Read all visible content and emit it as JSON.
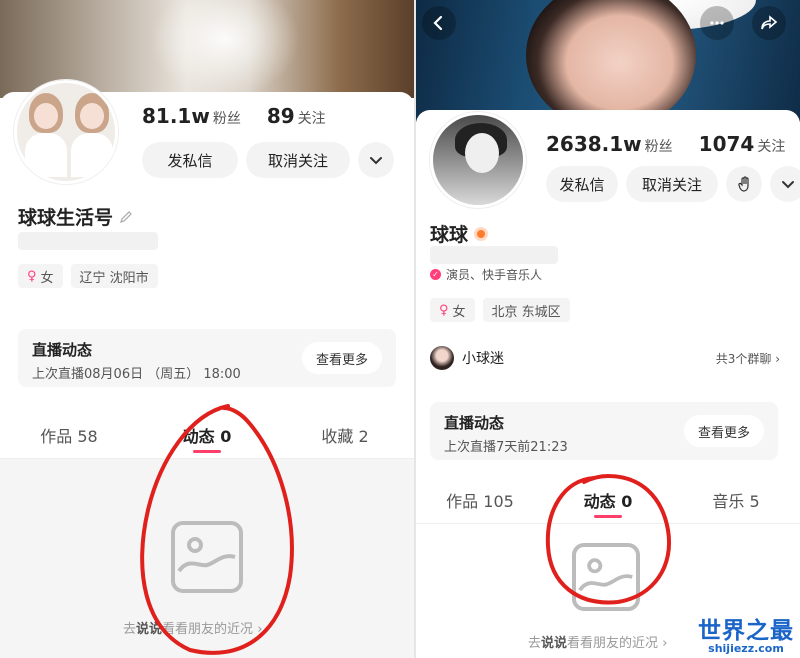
{
  "left": {
    "stats": {
      "fans_num": "81.1w",
      "fans_label": "粉丝",
      "follow_num": "89",
      "follow_label": "关注"
    },
    "actions": {
      "message": "发私信",
      "unfollow": "取消关注"
    },
    "name": "球球生活号",
    "tags": {
      "gender": "女",
      "location": "辽宁 沈阳市"
    },
    "live": {
      "title": "直播动态",
      "subtitle": "上次直播08月06日 （周五） 18:00",
      "more": "查看更多"
    },
    "tabs": [
      "作品 58",
      "动态 0",
      "收藏 2"
    ],
    "empty_hint": {
      "pre": "去",
      "strong": "说说",
      "post": "看看朋友的近况",
      "arrow": "›"
    }
  },
  "right": {
    "stats": {
      "fans_num": "2638.1w",
      "fans_label": "粉丝",
      "follow_num": "1074",
      "follow_label": "关注"
    },
    "actions": {
      "message": "发私信",
      "unfollow": "取消关注"
    },
    "name": "球球",
    "desc": "演员、快手音乐人",
    "tags": {
      "gender": "女",
      "location": "北京 东城区"
    },
    "fan_group": {
      "name": "小球迷",
      "count": "共3个群聊",
      "arrow": "›"
    },
    "live": {
      "title": "直播动态",
      "subtitle": "上次直播7天前21:23",
      "more": "查看更多"
    },
    "tabs": [
      "作品 105",
      "动态 0",
      "音乐 5"
    ],
    "empty_hint": {
      "pre": "去",
      "strong": "说说",
      "post": "看看朋友的近况",
      "arrow": "›"
    }
  },
  "watermark": {
    "cn": "世界之最",
    "url": "shijiezz.com"
  },
  "colors": {
    "accent": "#ff3e6a",
    "annotation": "#e0201c",
    "watermark": "#1b64c8"
  }
}
